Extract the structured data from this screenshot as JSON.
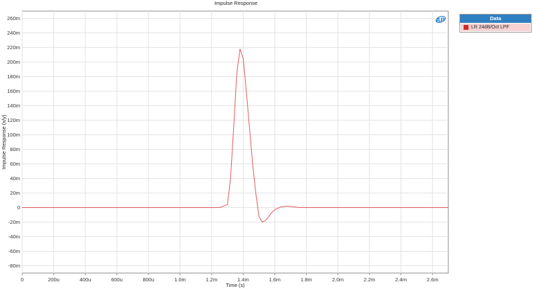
{
  "chart_data": {
    "type": "line",
    "title": "Impulse Response",
    "xlabel": "Time (s)",
    "ylabel": "Impulse Response (x/y)",
    "xlim": [
      0,
      0.0027
    ],
    "ylim": [
      -0.09,
      0.27
    ],
    "x_tick_values": [
      0,
      0.0002,
      0.0004,
      0.0006,
      0.0008,
      0.001,
      0.0012,
      0.0014,
      0.0016,
      0.0018,
      0.002,
      0.0022,
      0.0024,
      0.0026
    ],
    "x_tick_labels": [
      "0",
      "200u",
      "400u",
      "600u",
      "800u",
      "1.0m",
      "1.2m",
      "1.4m",
      "1.6m",
      "1.8m",
      "2.0m",
      "2.2m",
      "2.4m",
      "2.6m"
    ],
    "y_tick_values": [
      -0.08,
      -0.06,
      -0.04,
      -0.02,
      0,
      0.02,
      0.04,
      0.06,
      0.08,
      0.1,
      0.12,
      0.14,
      0.16,
      0.18,
      0.2,
      0.22,
      0.24,
      0.26
    ],
    "y_tick_labels": [
      "-80m",
      "-60m",
      "-40m",
      "-20m",
      "0",
      "20m",
      "40m",
      "60m",
      "80m",
      "100m",
      "120m",
      "140m",
      "160m",
      "180m",
      "200m",
      "220m",
      "240m",
      "260m"
    ],
    "grid": true,
    "legend_position": "right",
    "series": [
      {
        "name": "LR 24dB/Oct LPF",
        "color": "#e05a5a",
        "x": [
          0,
          0.00125,
          0.0013,
          0.00132,
          0.00134,
          0.00136,
          0.00138,
          0.0014,
          0.00142,
          0.00144,
          0.00146,
          0.00148,
          0.0015,
          0.00152,
          0.00154,
          0.00156,
          0.00158,
          0.0016,
          0.00164,
          0.00168,
          0.00172,
          0.00176,
          0.0018,
          0.0027
        ],
        "y": [
          0,
          0,
          0.004,
          0.04,
          0.11,
          0.185,
          0.218,
          0.205,
          0.16,
          0.11,
          0.06,
          0.02,
          -0.012,
          -0.02,
          -0.018,
          -0.013,
          -0.007,
          -0.003,
          0.001,
          0.002,
          0.001,
          0,
          0,
          0
        ]
      }
    ]
  },
  "legend": {
    "header": "Data",
    "items": [
      {
        "label": "LR 24dB/Oct LPF",
        "color": "#d62828"
      }
    ]
  },
  "logo": {
    "text": "AP",
    "color": "#1f78c8"
  }
}
